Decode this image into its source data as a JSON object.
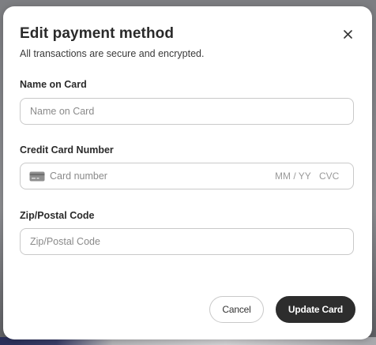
{
  "dialog": {
    "title": "Edit payment method",
    "subtitle": "All transactions are secure and encrypted.",
    "close_icon": "close-icon"
  },
  "fields": {
    "name": {
      "label": "Name on Card",
      "value": "",
      "placeholder": "Name on Card"
    },
    "card": {
      "label": "Credit Card Number",
      "value": "",
      "placeholder": "Card number",
      "icon": "credit-card-icon",
      "expiry_placeholder": "MM / YY",
      "cvc_placeholder": "CVC"
    },
    "zip": {
      "label": "Zip/Postal Code",
      "value": "",
      "placeholder": "Zip/Postal Code"
    }
  },
  "actions": {
    "cancel_label": "Cancel",
    "update_label": "Update Card"
  },
  "colors": {
    "primary_button": "#2d2d2d",
    "border": "#c9c9c9",
    "text": "#2a2a2a"
  }
}
